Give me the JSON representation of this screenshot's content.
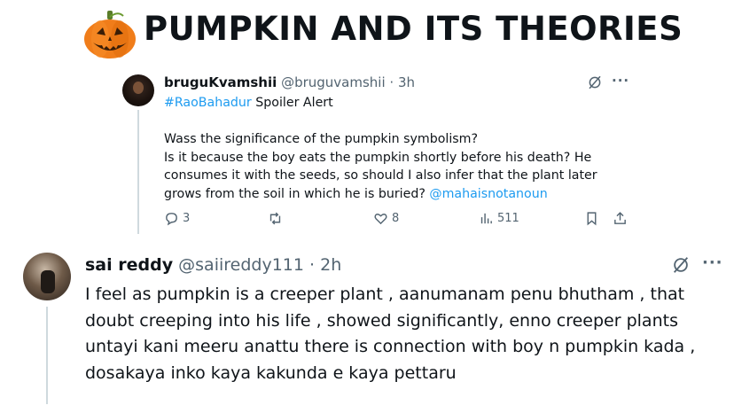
{
  "banner": {
    "title": "PUMPKIN AND ITS THEORIES",
    "icon": "jack-o-lantern-icon"
  },
  "quoted_tweet": {
    "display_name": "bruguKvamshii",
    "handle": "@bruguvamshii",
    "time": "· 3h",
    "hashtag": "#RaoBahadur",
    "intro": " Spoiler Alert",
    "line1": "Wass the significance of the pumpkin symbolism?",
    "line2": "Is it because the boy eats the pumpkin shortly before his death? He consumes it with the seeds, so should I also infer that the plant later grows from the soil in which he is buried? ",
    "mention": "@mahaisnotanoun",
    "replies": "3",
    "likes": "8",
    "views": "511"
  },
  "reply_tweet": {
    "display_name": "sai reddy",
    "handle": "@saiireddy111",
    "time": "· 2h",
    "text": "I feel as pumpkin is a creeper plant , aanumanam penu bhutham , that doubt creeping into his life , showed significantly, enno creeper plants untayi kani meeru anattu there is connection with boy n pumpkin kada , dosakaya inko kaya kakunda e kaya pettaru"
  },
  "colors": {
    "text": "#0f1419",
    "muted": "#536471",
    "link": "#1d9bf0",
    "pumpkin": "#f07d1a",
    "thread": "#cfd9de"
  }
}
